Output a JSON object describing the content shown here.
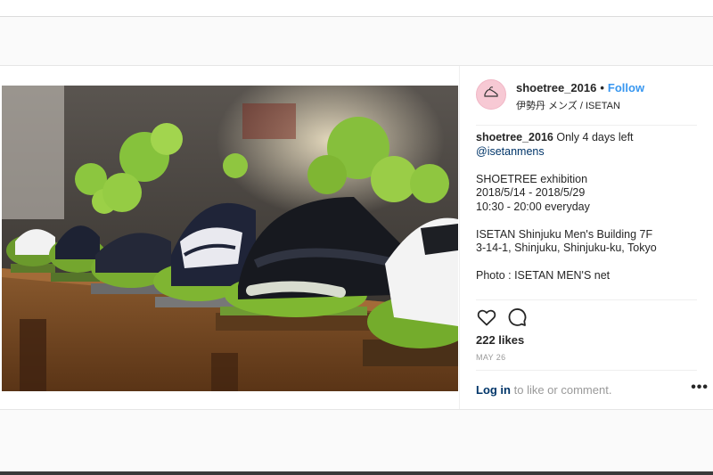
{
  "post": {
    "username": "shoetree_2016",
    "separator": "•",
    "follow_label": "Follow",
    "location": "伊勢丹 メンズ / ISETAN",
    "caption": {
      "username": "shoetree_2016",
      "first_line": "Only 4 days left",
      "mention": "@isetanmens",
      "lines": [
        "",
        "SHOETREE exhibition",
        "2018/5/14 - 2018/5/29",
        "10:30 - 20:00 everyday",
        "",
        "ISETAN Shinjuku Men's Building 7F",
        "3-14-1, Shinjuku, Shinjuku-ku, Tokyo",
        "",
        "Photo : ISETAN MEN'S net"
      ]
    },
    "likes": "222 likes",
    "date": "MAY 26",
    "login_link": "Log in",
    "login_rest": " to like or comment.",
    "more_label": "•••",
    "icons": {
      "like": "heart-icon",
      "comment": "comment-icon",
      "more": "more-options-icon",
      "avatar": "shoe-logo-icon"
    },
    "colors": {
      "accent": "#3897f0",
      "text": "#262626",
      "muted": "#999999",
      "link": "#003569"
    }
  }
}
